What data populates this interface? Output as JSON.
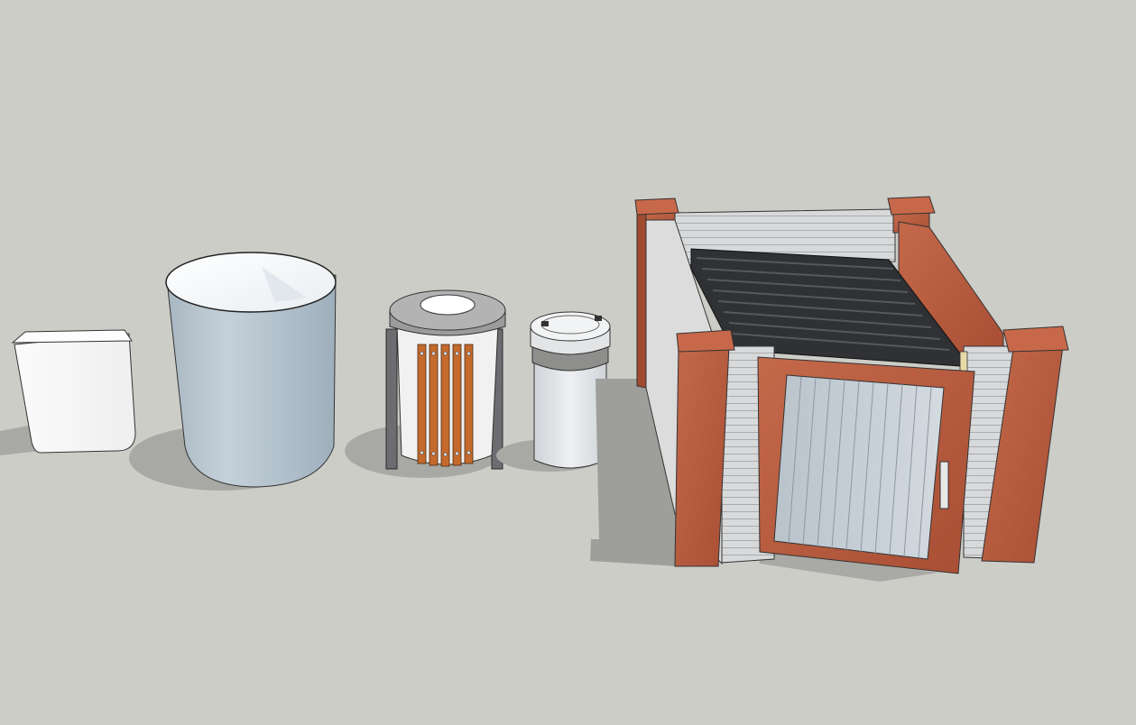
{
  "viewport": {
    "background": "#cdcdc8"
  },
  "objects": [
    {
      "id": "small-square-bin",
      "kind": "small square wastebasket",
      "color": "#f7f7f7"
    },
    {
      "id": "large-round-bin",
      "kind": "large round open bin",
      "color": "#b9c6d0"
    },
    {
      "id": "slatted-park-bin",
      "kind": "round bin with wooden slats and metal frame",
      "color": "#c46a2c"
    },
    {
      "id": "cylinder-lidded-bin",
      "kind": "cylindrical bin with lid",
      "color": "#e6e8ea"
    },
    {
      "id": "dumpster-enclosure",
      "kind": "brick-pillar dumpster enclosure with gate",
      "color": "#b85a3a"
    }
  ]
}
